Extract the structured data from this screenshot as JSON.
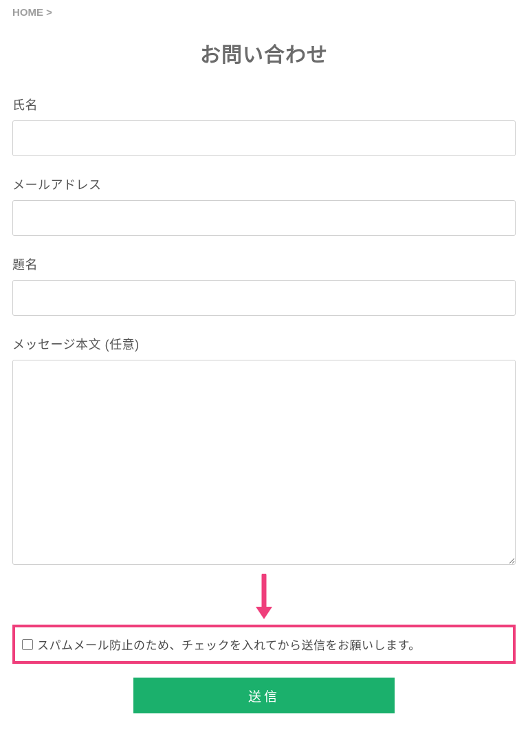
{
  "breadcrumb": {
    "home": "HOME",
    "separator": ">"
  },
  "page_title": "お問い合わせ",
  "form": {
    "name_label": "氏名",
    "email_label": "メールアドレス",
    "subject_label": "題名",
    "message_label": "メッセージ本文 (任意)",
    "spam_checkbox_label": "スパムメール防止のため、チェックを入れてから送信をお願いします。",
    "submit_label": "送信"
  },
  "annotation": {
    "arrow_color": "#ef3e7b",
    "highlight_color": "#ef3e7b"
  }
}
